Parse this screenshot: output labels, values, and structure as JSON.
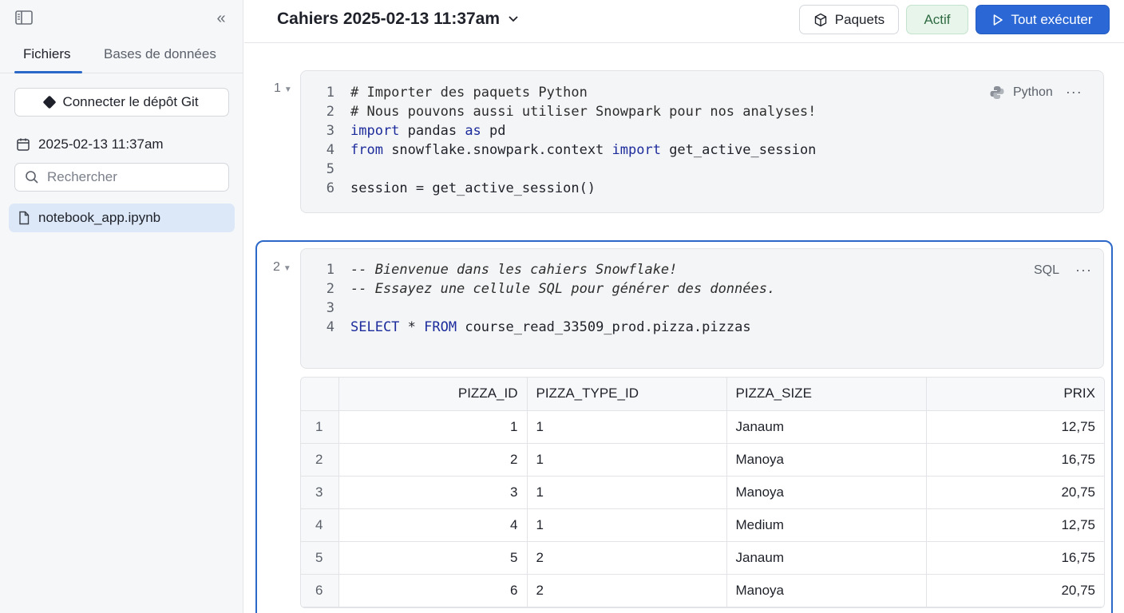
{
  "sidebar": {
    "tabs": [
      {
        "label": "Fichiers",
        "active": true
      },
      {
        "label": "Bases de données",
        "active": false
      }
    ],
    "git_button": "Connecter le dépôt Git",
    "notebook_name": "2025-02-13 11:37am",
    "search": {
      "placeholder": "Rechercher",
      "value": ""
    },
    "files": [
      {
        "name": "notebook_app.ipynb",
        "selected": true
      }
    ]
  },
  "header": {
    "title": "Cahiers 2025-02-13 11:37am",
    "packages_label": "Paquets",
    "status_label": "Actif",
    "run_all_label": "Tout exécuter"
  },
  "cells": [
    {
      "number": "1",
      "language": "Python",
      "lines": [
        "# Importer des paquets Python",
        "# Nous pouvons aussi utiliser Snowpark pour nos analyses!",
        "import pandas as pd",
        "from snowflake.snowpark.context import get_active_session",
        "",
        "session = get_active_session()"
      ]
    },
    {
      "number": "2",
      "language": "SQL",
      "lines": [
        "-- Bienvenue dans les cahiers Snowflake!",
        "-- Essayez une cellule SQL pour générer des données.",
        "",
        "SELECT * FROM course_read_33509_prod.pizza.pizzas"
      ]
    }
  ],
  "result_table": {
    "columns": [
      "PIZZA_ID",
      "PIZZA_TYPE_ID",
      "PIZZA_SIZE",
      "PRIX"
    ],
    "rows": [
      [
        "1",
        "1",
        "1",
        "Janaum",
        "12,75"
      ],
      [
        "2",
        "2",
        "1",
        "Manoya",
        "16,75"
      ],
      [
        "3",
        "3",
        "1",
        "Manoya",
        "20,75"
      ],
      [
        "4",
        "4",
        "1",
        "Medium",
        "12,75"
      ],
      [
        "5",
        "5",
        "2",
        "Janaum",
        "16,75"
      ],
      [
        "6",
        "6",
        "2",
        "Manoya",
        "20,75"
      ]
    ]
  },
  "colors": {
    "accent": "#2b68c7",
    "run_button": "#2b68d6",
    "status_bg": "#e7f5ea"
  }
}
